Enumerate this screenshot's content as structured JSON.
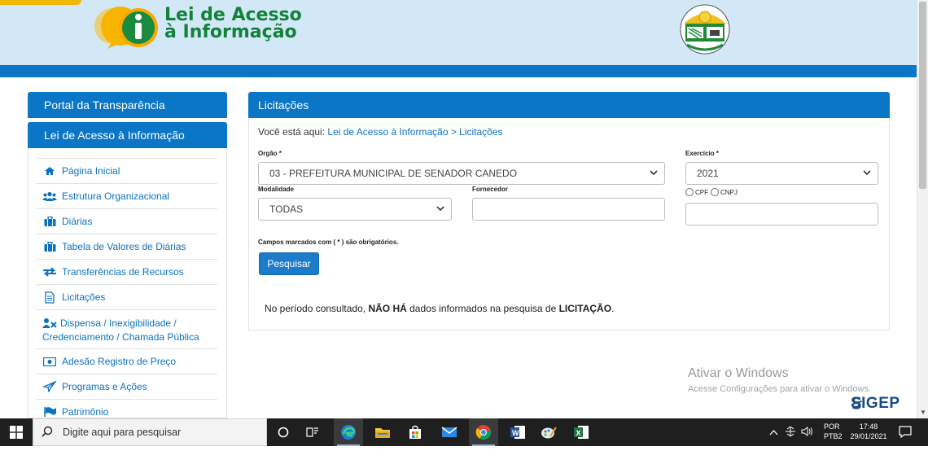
{
  "header": {
    "lai_title_line1": "Lei de Acesso",
    "lai_title_line2": "à Informação"
  },
  "sidebar": {
    "portal_label": "Portal da Transparência",
    "lai_label": "Lei de Acesso à Informação",
    "items": [
      {
        "label": "Página Inicial",
        "icon": "home-icon"
      },
      {
        "label": "Estrutura Organizacional",
        "icon": "users-icon"
      },
      {
        "label": "Diárias",
        "icon": "briefcase-icon"
      },
      {
        "label": "Tabela de Valores de Diárias",
        "icon": "briefcase-icon"
      },
      {
        "label": "Transferências de Recursos",
        "icon": "exchange-icon"
      },
      {
        "label": "Licitações",
        "icon": "document-icon"
      },
      {
        "label": "Dispensa / Inexigibilidade / Credenciamento / Chamada Pública",
        "icon": "user-times-icon"
      },
      {
        "label": "Adesão Registro de Preço",
        "icon": "money-icon"
      },
      {
        "label": "Programas e Ações",
        "icon": "paper-plane-icon"
      },
      {
        "label": "Patrimônio",
        "icon": "flag-icon"
      }
    ]
  },
  "main": {
    "title": "Licitações",
    "breadcrumb_prefix": "Você está aqui:",
    "breadcrumb_path": "Lei de Acesso à Informação > Licitações",
    "orgao_label": "Orgão *",
    "orgao_value": "03 - PREFEITURA MUNICIPAL DE SENADOR CANEDO",
    "exercicio_label": "Exercício *",
    "exercicio_value": "2021",
    "modalidade_label": "Modalidade",
    "modalidade_value": "TODAS",
    "fornecedor_label": "Fornecedor",
    "fornecedor_value": "",
    "radio_cpf": "CPF",
    "radio_cnpj": "CNPJ",
    "doc_value": "",
    "required_note": "Campos marcados com ( * ) são obrigatórios.",
    "search_button": "Pesquisar",
    "result_part1": "No período consultado,",
    "result_bold1": "NÃO HÁ",
    "result_part2": "dados informados na pesquisa de",
    "result_bold2": "LICITAÇÃO",
    "result_end": "."
  },
  "watermark": {
    "title": "Ativar o Windows",
    "subtitle": "Acesse Configurações para ativar o Windows."
  },
  "brand": {
    "sigep": "SIGEP"
  },
  "taskbar": {
    "search_placeholder": "Digite aqui para pesquisar",
    "lang_line1": "POR",
    "lang_line2": "PTB2",
    "time": "17:48",
    "date": "29/01/2021"
  },
  "colors": {
    "primary_blue": "#0a76c5",
    "header_bg": "#d3e8f7",
    "logo_green": "#12823a",
    "logo_yellow": "#f2b705"
  }
}
